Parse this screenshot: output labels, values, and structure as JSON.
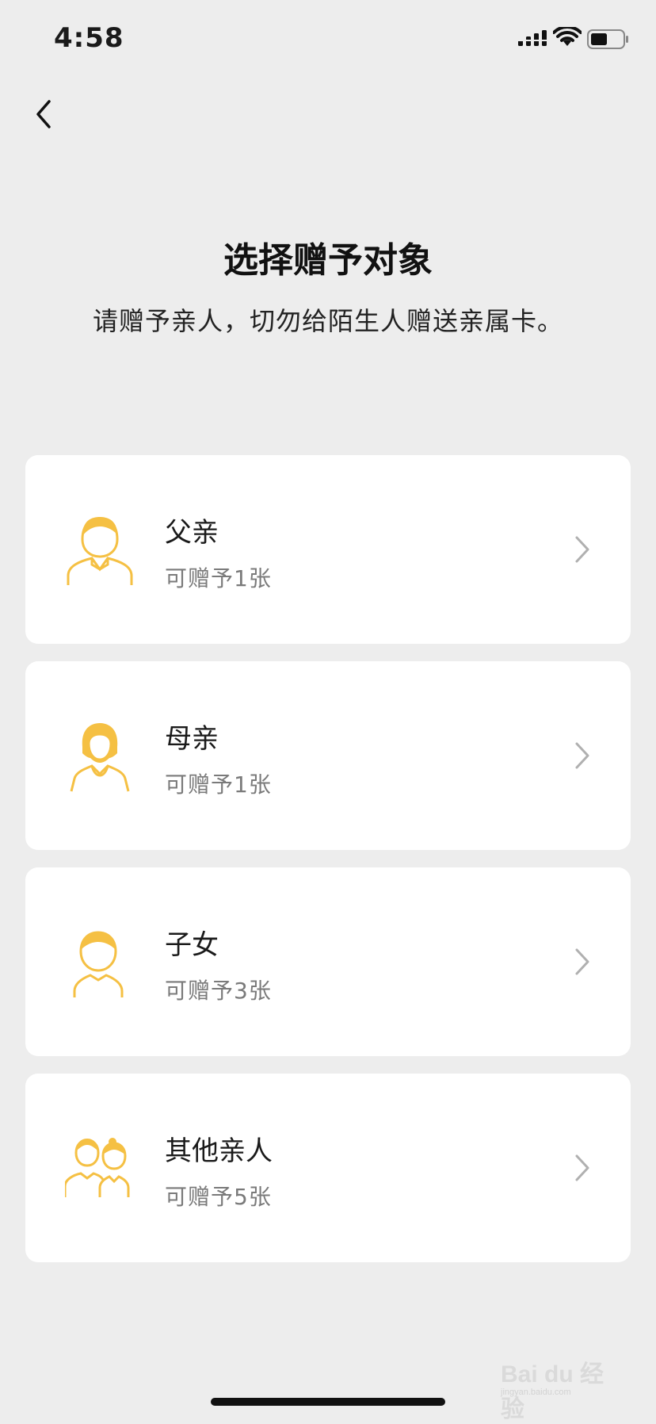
{
  "status_bar": {
    "time": "4:58"
  },
  "header": {
    "title": "选择赠予对象",
    "subtitle": "请赠予亲人，切勿给陌生人赠送亲属卡。"
  },
  "icons": {
    "back": "chevron-left-icon",
    "arrow": "chevron-right-icon"
  },
  "colors": {
    "accent": "#F5C043",
    "background": "#EDEDED",
    "card": "#FFFFFF"
  },
  "options": [
    {
      "name": "父亲",
      "quota": "可赠予1张",
      "icon": "father-icon"
    },
    {
      "name": "母亲",
      "quota": "可赠予1张",
      "icon": "mother-icon"
    },
    {
      "name": "子女",
      "quota": "可赠予3张",
      "icon": "child-icon"
    },
    {
      "name": "其他亲人",
      "quota": "可赠予5张",
      "icon": "other-relatives-icon"
    }
  ],
  "watermark": {
    "text": "Bai du 经验",
    "sub": "jingyan.baidu.com"
  }
}
